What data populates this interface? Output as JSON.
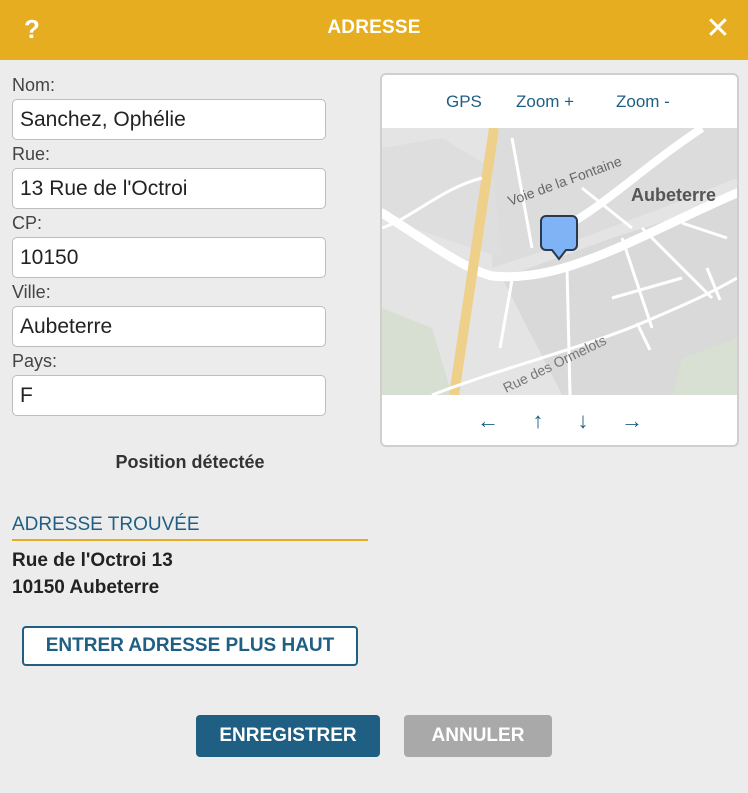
{
  "header": {
    "help_label": "?",
    "title": "ADRESSE",
    "close_label": "✕",
    "background_color": "#e6ad21"
  },
  "form": {
    "name_label": "Nom:",
    "name_value": "Sanchez, Ophélie",
    "street_label": "Rue:",
    "street_value": "13 Rue de l'Octroi",
    "zip_label": "CP:",
    "zip_value": "10150",
    "city_label": "Ville:",
    "city_value": "Aubeterre",
    "country_label": "Pays:",
    "country_value": "F"
  },
  "map": {
    "gps_label": "GPS",
    "zoom_in_label": "Zoom +",
    "zoom_out_label": "Zoom -",
    "labels": {
      "road_1": "Voie de la Fontaine",
      "town": "Aubeterre",
      "road_2": "Rue des Ormelots"
    },
    "arrows": {
      "left": "←",
      "up": "↑",
      "down": "↓",
      "right": "→"
    },
    "marker_color": "#7fb3f5"
  },
  "status": {
    "position_text": "Position détectée"
  },
  "found": {
    "title": "ADRESSE TROUVÉE",
    "line1": "Rue de l'Octroi 13",
    "line2": "10150 Aubeterre"
  },
  "buttons": {
    "enter_address": "ENTRER ADRESSE PLUS HAUT",
    "save": "ENREGISTRER",
    "cancel": "ANNULER"
  },
  "colors": {
    "accent_blue": "#1f5f83",
    "cancel_gray": "#a9a9a9"
  }
}
